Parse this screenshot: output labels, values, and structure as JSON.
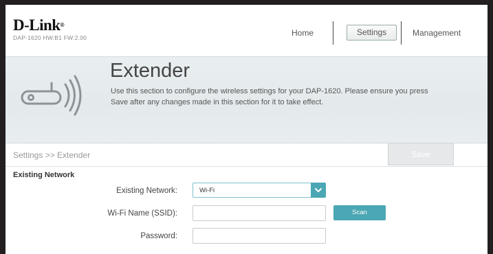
{
  "header": {
    "logo": "D-Link",
    "logo_mark": "®",
    "model_info": "DAP-1620  HW:B1  FW:2.00",
    "nav": {
      "home": "Home",
      "settings": "Settings",
      "management": "Management"
    }
  },
  "banner": {
    "title": "Extender",
    "description": "Use this section to configure the wireless settings for your DAP-1620. Please ensure you press Save after any changes made in this section for it to take effect.",
    "icon": "router-wifi-icon"
  },
  "breadcrumb": "Settings >> Extender",
  "save_label": "Save",
  "section": {
    "title": "Existing Network",
    "fields": {
      "existing_network_label": "Existing Network:",
      "existing_network_value": "Wi-Fi",
      "ssid_label": "Wi-Fi Name (SSID):",
      "ssid_value": "",
      "password_label": "Password:",
      "password_value": ""
    },
    "scan_label": "Scan"
  },
  "colors": {
    "accent": "#4aa7b3",
    "frame": "#231f20"
  }
}
